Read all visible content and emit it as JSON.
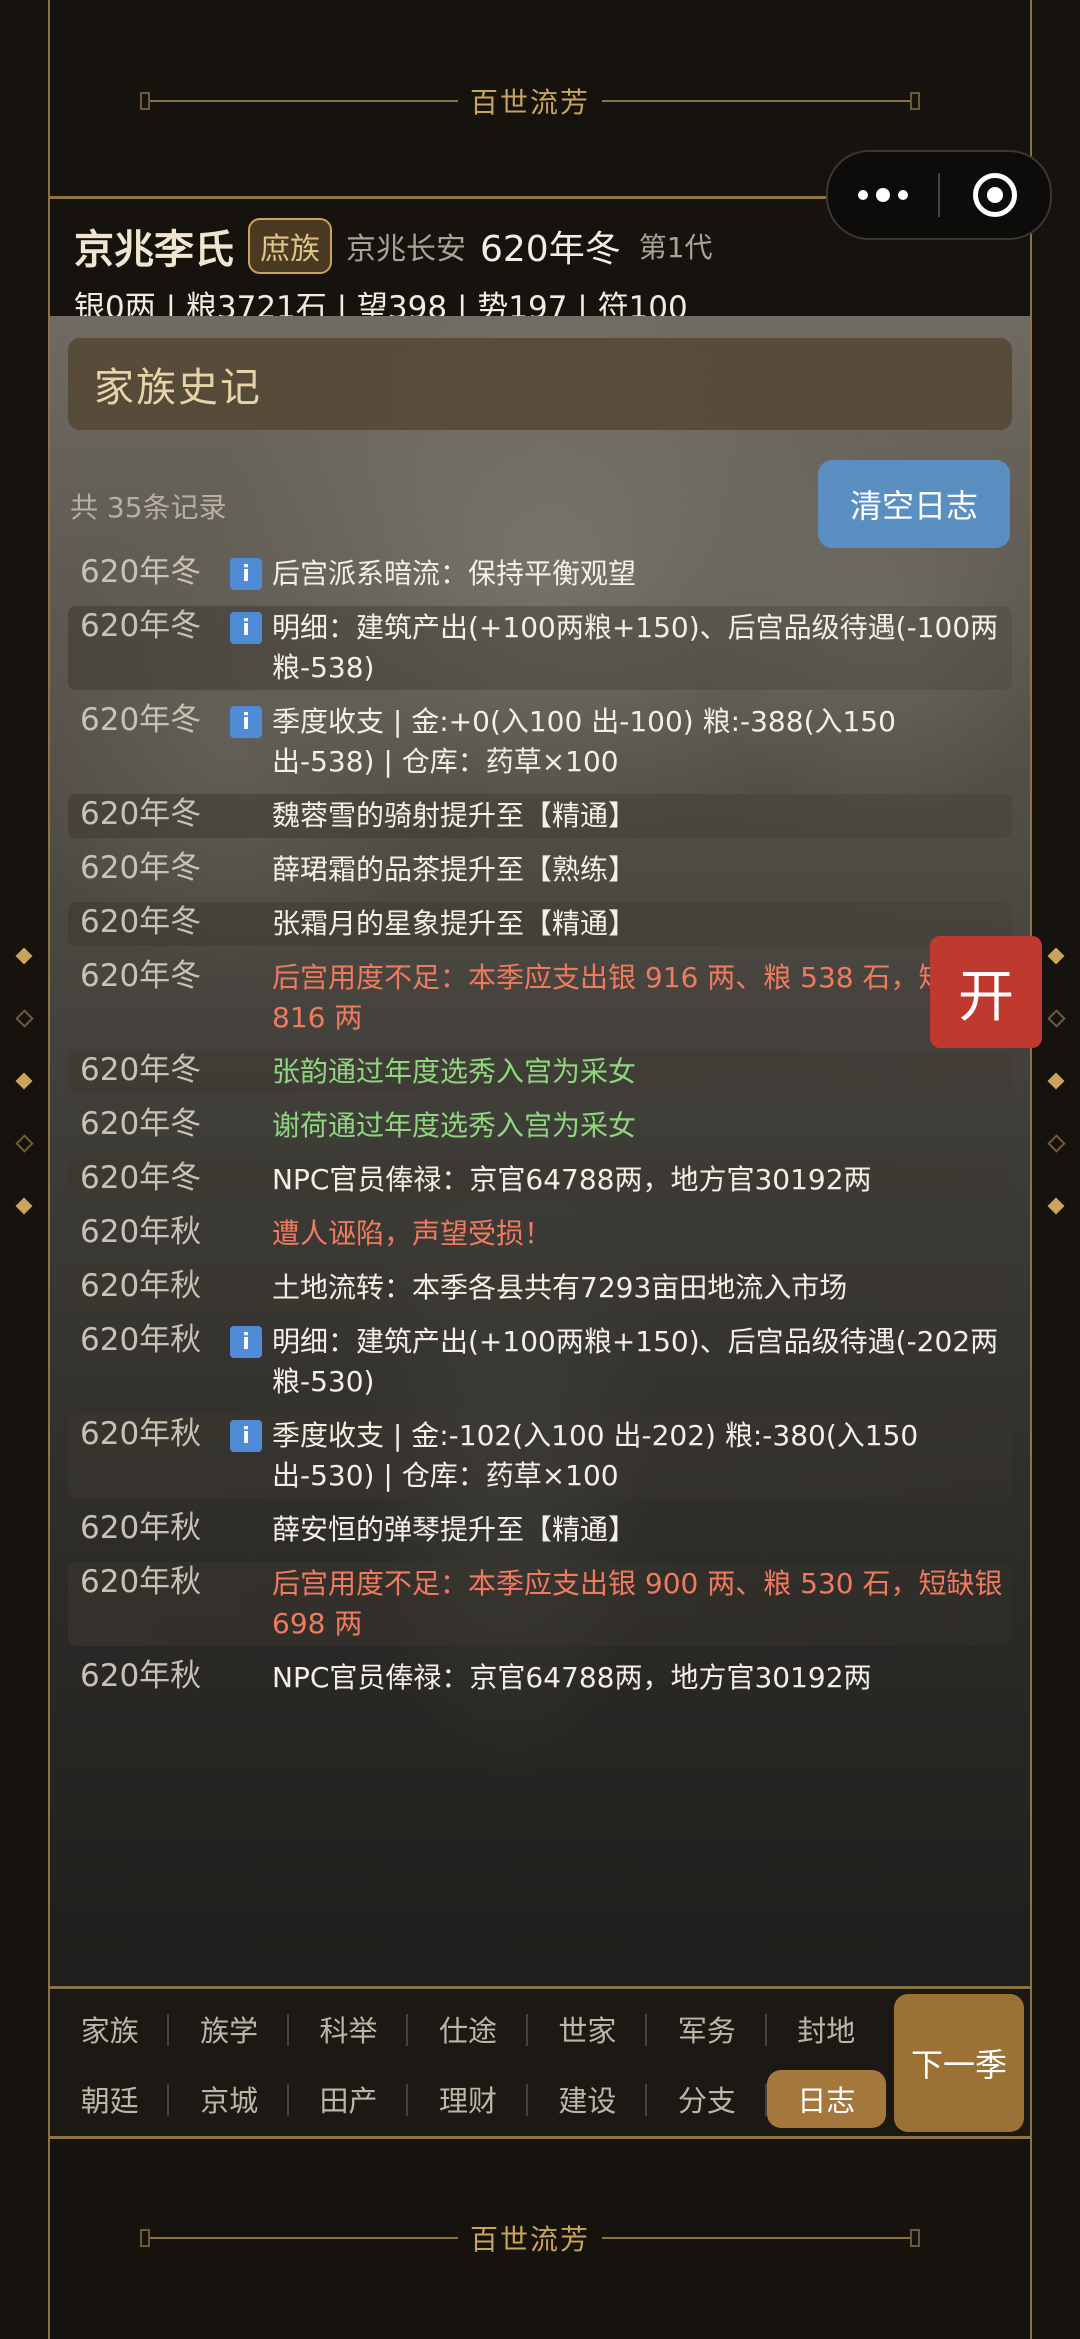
{
  "app": {
    "title": "百世流芳",
    "footer_title": "百世流芳"
  },
  "header": {
    "clan_name": "京兆李氏",
    "clan_rank": "庶族",
    "location": "京兆长安",
    "season": "620年冬",
    "generation": "第1代",
    "resources": "银0两 | 粮3721石 | 望398 | 势197 | 符100"
  },
  "chronicle": {
    "title": "家族史记",
    "record_count": "共 35条记录",
    "clear_label": "清空日志",
    "entries": [
      {
        "date": "620年冬",
        "info": true,
        "text": "后宫派系暗流：保持平衡观望",
        "tone": "normal"
      },
      {
        "date": "620年冬",
        "info": true,
        "text": "明细：建筑产出(+100两粮+150)、后宫品级待遇(-100两粮-538)",
        "tone": "normal"
      },
      {
        "date": "620年冬",
        "info": true,
        "text": "季度收支 | 金:+0(入100 出-100) 粮:-388(入150 出-538) | 仓库：药草×100",
        "tone": "normal"
      },
      {
        "date": "620年冬",
        "info": false,
        "text": "魏蓉雪的骑射提升至【精通】",
        "tone": "normal"
      },
      {
        "date": "620年冬",
        "info": false,
        "text": "薛珺霜的品茶提升至【熟练】",
        "tone": "normal"
      },
      {
        "date": "620年冬",
        "info": false,
        "text": "张霜月的星象提升至【精通】",
        "tone": "normal"
      },
      {
        "date": "620年冬",
        "info": false,
        "text": "后宫用度不足：本季应支出银 916 两、粮 538 石，短缺银 816 两",
        "tone": "red"
      },
      {
        "date": "620年冬",
        "info": false,
        "text": "张韵通过年度选秀入宫为采女",
        "tone": "green"
      },
      {
        "date": "620年冬",
        "info": false,
        "text": "谢荷通过年度选秀入宫为采女",
        "tone": "green"
      },
      {
        "date": "620年冬",
        "info": false,
        "text": "NPC官员俸禄：京官64788两，地方官30192两",
        "tone": "normal"
      },
      {
        "date": "620年秋",
        "info": false,
        "text": "遭人诬陷，声望受损！",
        "tone": "red"
      },
      {
        "date": "620年秋",
        "info": false,
        "text": "土地流转：本季各县共有7293亩田地流入市场",
        "tone": "normal"
      },
      {
        "date": "620年秋",
        "info": true,
        "text": "明细：建筑产出(+100两粮+150)、后宫品级待遇(-202两粮-530)",
        "tone": "normal"
      },
      {
        "date": "620年秋",
        "info": true,
        "text": "季度收支 | 金:-102(入100 出-202) 粮:-380(入150 出-530) | 仓库：药草×100",
        "tone": "normal"
      },
      {
        "date": "620年秋",
        "info": false,
        "text": "薛安恒的弹琴提升至【精通】",
        "tone": "normal"
      },
      {
        "date": "620年秋",
        "info": false,
        "text": "后宫用度不足：本季应支出银 900 两、粮 530 石，短缺银 698 两",
        "tone": "red"
      },
      {
        "date": "620年秋",
        "info": false,
        "text": "NPC官员俸禄：京官64788两，地方官30192两",
        "tone": "normal"
      }
    ]
  },
  "float_button": {
    "label": "开"
  },
  "nav": {
    "row1": [
      "家族",
      "族学",
      "科举",
      "仕途",
      "世家",
      "军务",
      "封地"
    ],
    "row2": [
      "朝廷",
      "京城",
      "田产",
      "理财",
      "建设",
      "分支",
      "日志"
    ],
    "active": "日志",
    "next_label": "下一季"
  },
  "icons": {
    "info": "info-icon",
    "menu": "more-dots-icon",
    "close": "target-circle-icon"
  },
  "colors": {
    "accent": "#c9a45a",
    "info": "#4f8bd6",
    "warning": "#f07a5e",
    "success": "#8fd67f",
    "clear_button": "#5b8fc2",
    "open_button": "#c0392f",
    "next_button": "#9b7136"
  }
}
